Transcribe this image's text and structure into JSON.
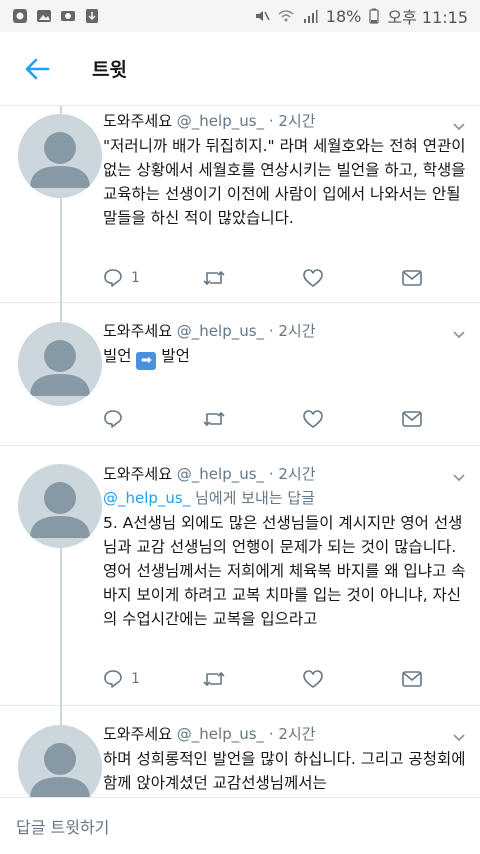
{
  "status_bar": {
    "battery": "18%",
    "time": "오후 11:15"
  },
  "header": {
    "title": "트윗"
  },
  "tweets": [
    {
      "name": "도와주세요",
      "handle": "@_help_us_",
      "time": "· 2시간",
      "text": "\"저러니까 배가 뒤집히지.\" 라며 세월호와는 전혀 연관이 없는 상황에서 세월호를 연상시키는 빌언을 하고, 학생을 교육하는 선생이기 이전에 사람이 입에서 나와서는 안될 말들을 하신 적이 많았습니다.",
      "reply_count": "1"
    },
    {
      "name": "도와주세요",
      "handle": "@_help_us_",
      "time": "· 2시간",
      "text_before": "빌언",
      "text_after": "발언",
      "reply_count": ""
    },
    {
      "name": "도와주세요",
      "handle": "@_help_us_",
      "time": "· 2시간",
      "reply_to_handle": "@_help_us_",
      "reply_to_suffix": " 님에게 보내는 답글",
      "text": "5. A선생님 외에도 많은 선생님들이 계시지만 영어 선생님과 교감 선생님의 언행이 문제가 되는 것이 많습니다. 영어 선생님께서는 저희에게 체육복 바지를 왜 입냐고 속바지 보이게 하려고 교복 치마를 입는 것이 아니냐, 자신의 수업시간에는 교복을 입으라고",
      "reply_count": "1"
    },
    {
      "name": "도와주세요",
      "handle": "@_help_us_",
      "time": "· 2시간",
      "text": "하며 성희롱적인 발언을 많이 하십니다. 그리고 공청회에 함께 앉아계셨던 교감선생님께서는"
    }
  ],
  "footer": {
    "reply_placeholder": "답글 트윗하기"
  },
  "colors": {
    "accent": "#1da1f2",
    "secondary_text": "#657786",
    "divider": "#e1e8ed"
  }
}
